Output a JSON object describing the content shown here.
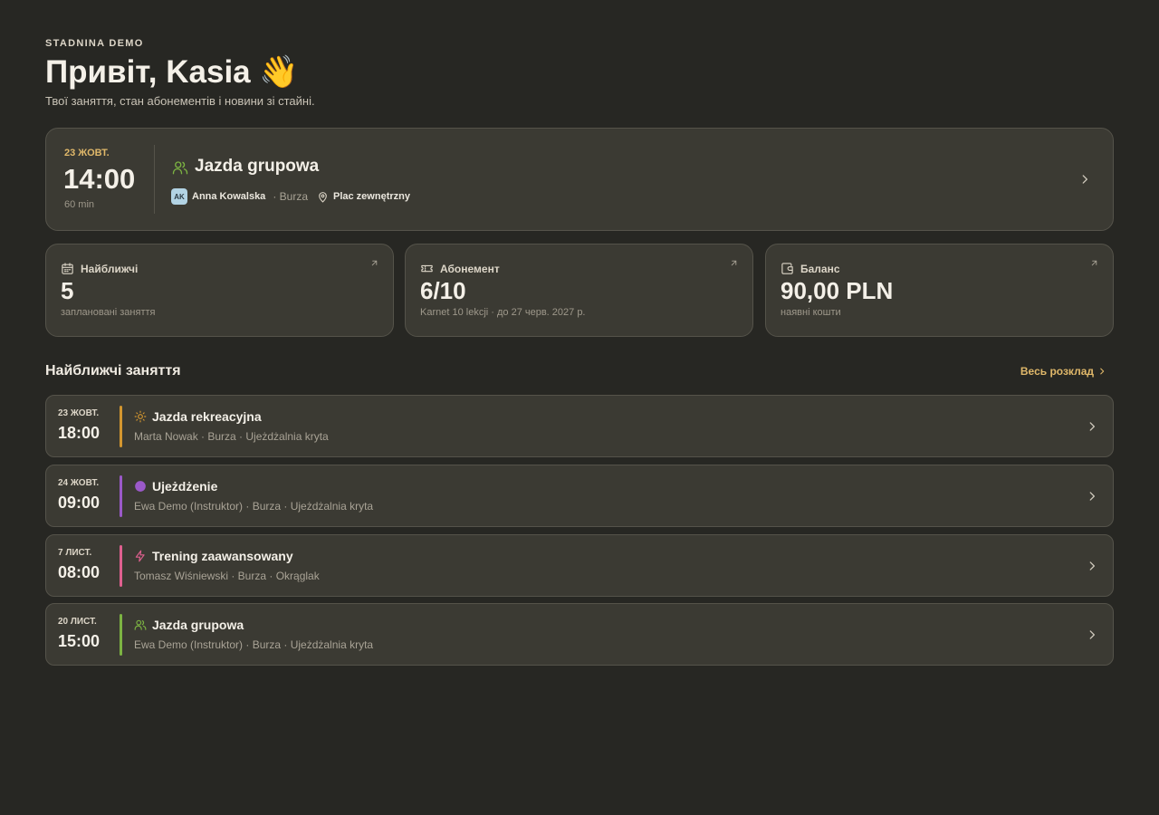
{
  "app": {
    "brand": "STADNINA DEMO"
  },
  "header": {
    "greeting": "Привіт, Kasia 👋",
    "subtitle": "Твої заняття, стан абонементів і новини зі стайні."
  },
  "next_lesson": {
    "date": "23 ЖОВТ.",
    "time": "14:00",
    "duration": "60 min",
    "type_icon": "users-icon",
    "title": "Jazda grupowa",
    "instructor_initials": "AK",
    "instructor": "Anna Kowalska",
    "horse": "· Burza",
    "location": "Plac zewnętrzny"
  },
  "stats": [
    {
      "icon": "calendar-icon",
      "label": "Найближчі",
      "value": "5",
      "sub": "заплановані заняття"
    },
    {
      "icon": "ticket-icon",
      "label": "Абонемент",
      "value": "6/10",
      "sub": "Karnet 10 lekcji · до 27 черв. 2027 р."
    },
    {
      "icon": "wallet-icon",
      "label": "Баланс",
      "value": "90,00 PLN",
      "sub": "наявні кошти"
    }
  ],
  "upcoming": {
    "title": "Найближчі заняття",
    "see_all": "Весь розклад",
    "items": [
      {
        "date": "23 ЖОВТ.",
        "time": "18:00",
        "title": "Jazda rekreacyjna",
        "meta": "Marta Nowak · Burza · Ujeżdżalnia kryta",
        "color": "#d3962f",
        "icon": "sun-icon"
      },
      {
        "date": "24 ЖОВТ.",
        "time": "09:00",
        "title": "Ujeżdżenie",
        "meta": "Ewa Demo (Instruktor) · Burza · Ujeżdżalnia kryta",
        "color": "#9b59c9",
        "icon": "circle-icon"
      },
      {
        "date": "7 ЛИСТ.",
        "time": "08:00",
        "title": "Trening zaawansowany",
        "meta": "Tomasz Wiśniewski · Burza · Okrąglak",
        "color": "#e0608f",
        "icon": "bolt-icon"
      },
      {
        "date": "20 ЛИСТ.",
        "time": "15:00",
        "title": "Jazda grupowa",
        "meta": "Ewa Demo (Instruktor) · Burza · Ujeżdżalnia kryta",
        "color": "#7cb342",
        "icon": "users-icon"
      }
    ]
  },
  "colors": {
    "accent": "#e0b86a",
    "background": "#272723",
    "card": "#3b3a33"
  }
}
